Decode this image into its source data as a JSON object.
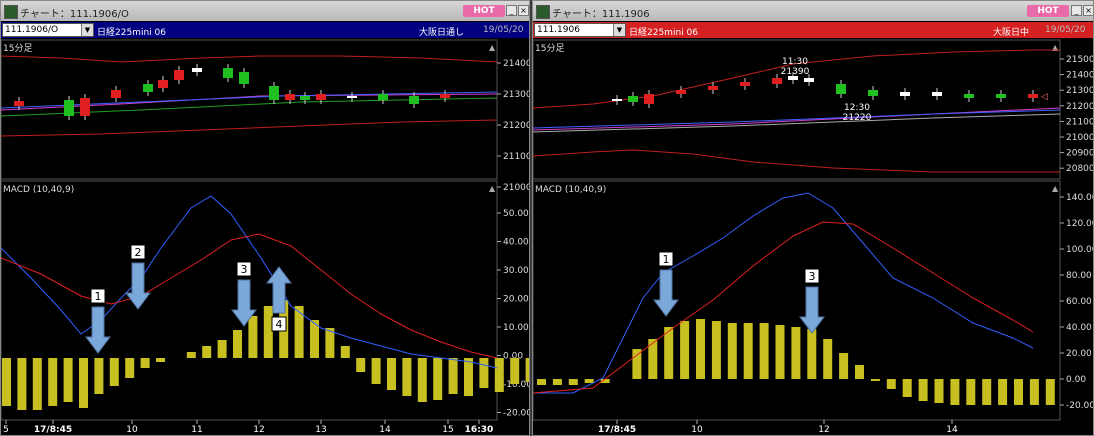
{
  "left": {
    "title": "チャート：111.1906/O",
    "hot": "HOT",
    "symbol": "111.1906/O",
    "instrument": "日経225mini 06",
    "session": "大阪日通し",
    "date": "19/05/20",
    "colors": {
      "bar": "#000080"
    },
    "price_panel": {
      "label": "15分足",
      "y_ticks": [
        "21400",
        "21300",
        "21200",
        "21100",
        "21000"
      ]
    },
    "macd_panel": {
      "label": "MACD (10,40,9)",
      "y_ticks": [
        "50.00",
        "40.00",
        "30.00",
        "20.00",
        "10.00",
        "0.00",
        "-10.00",
        "-20.00"
      ]
    },
    "x_ticks": [
      "5",
      "17/8:45",
      "10",
      "11",
      "12",
      "13",
      "14",
      "15",
      "16:30"
    ],
    "annotations": [
      "1",
      "2",
      "3",
      "4"
    ]
  },
  "right": {
    "title": "チャート：111.1906",
    "hot": "HOT",
    "symbol": "111.1906",
    "instrument": "日経225mini 06",
    "session": "大阪日中",
    "date": "19/05/20",
    "colors": {
      "bar": "#d42020"
    },
    "price_panel": {
      "label": "15分足",
      "y_ticks": [
        "21500",
        "21400",
        "21300",
        "21200",
        "21100",
        "21000",
        "20900",
        "20800"
      ],
      "callouts": [
        {
          "time": "11:30",
          "price": "21390"
        },
        {
          "time": "12:30",
          "price": "21220"
        }
      ]
    },
    "macd_panel": {
      "label": "MACD (10,40,9)",
      "y_ticks": [
        "140.00",
        "120.00",
        "100.00",
        "80.00",
        "60.00",
        "40.00",
        "20.00",
        "0.00",
        "-20.00"
      ]
    },
    "x_ticks": [
      "17/8:45",
      "10",
      "12",
      "14"
    ],
    "annotations": [
      "1",
      "3"
    ]
  }
}
